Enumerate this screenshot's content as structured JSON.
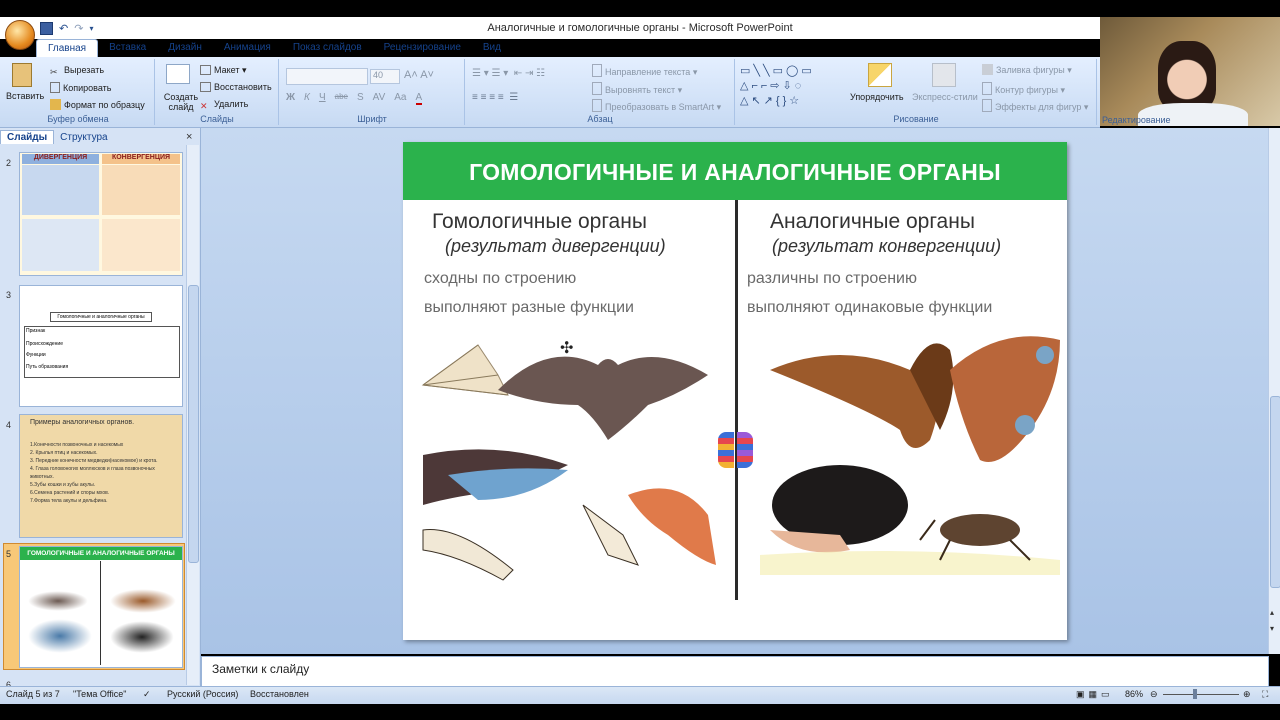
{
  "window": {
    "title": "Аналогичные  и гомологичные органы - Microsoft PowerPoint"
  },
  "ribbon": {
    "tabs": [
      "Главная",
      "Вставка",
      "Дизайн",
      "Анимация",
      "Показ слайдов",
      "Рецензирование",
      "Вид"
    ],
    "active_tab": "Главная",
    "clipboard": {
      "title": "Буфер обмена",
      "paste": "Вставить",
      "cut": "Вырезать",
      "copy": "Копировать",
      "format": "Формат по образцу"
    },
    "slides": {
      "title": "Слайды",
      "create": "Создать слайд",
      "layout": "Макет",
      "reset": "Восстановить",
      "delete": "Удалить"
    },
    "font": {
      "title": "Шрифт",
      "size": "40",
      "buttons": [
        "Ж",
        "К",
        "Ч",
        "abe",
        "S",
        "AV",
        "Aa",
        "A"
      ]
    },
    "paragraph": {
      "title": "Абзац",
      "text_direction": "Направление текста",
      "align_text": "Выровнять текст",
      "smartart": "Преобразовать в SmartArt"
    },
    "drawing": {
      "title": "Рисование",
      "arrange": "Упорядочить",
      "quick_styles": "Экспресс-стили",
      "fill": "Заливка фигуры",
      "outline": "Контур фигуры",
      "effects": "Эффекты для фигур"
    },
    "editing": {
      "title": "Редактирование"
    }
  },
  "left_panel": {
    "tabs": [
      "Слайды",
      "Структура"
    ],
    "close": "×",
    "slide_numbers": [
      "2",
      "3",
      "4",
      "5",
      "6"
    ],
    "thumb2": {
      "left_head": "ДИВЕРГЕНЦИЯ",
      "right_head": "КОНВЕРГЕНЦИЯ"
    },
    "thumb3": {
      "title": "Гомологичные и аналогичные органы",
      "row1": "Признак",
      "row2": "Происхождение",
      "row3": "Функции",
      "row4": "Путь образования"
    },
    "thumb4": {
      "title": "Примеры аналогичных органов.",
      "items": [
        "1.Конечности позвоночных и насекомых",
        "2. Крылья птиц и насекомых.",
        "3. Передние конечности медведки(насекомое) и крота.",
        "4. Глаза головоногих моллюсков и глаза позвоночных животных.",
        "5.Зубы кошки и зубы акулы.",
        "6.Семена растений и споры мхов.",
        "7.Форма тела акулы и дельфина."
      ]
    },
    "thumb5": {
      "title": "ГОМОЛОГИЧНЫЕ И АНАЛОГИЧНЫЕ ОРГАНЫ"
    }
  },
  "slide": {
    "banner": "ГОМОЛОГИЧНЫЕ И АНАЛОГИЧНЫЕ ОРГАНЫ",
    "left": {
      "title": "Гомологичные органы",
      "subtitle": "(результат дивергенции)",
      "line1": "сходны по строению",
      "line2": "выполняют разные функции"
    },
    "right": {
      "title": "Аналогичные органы",
      "subtitle": "(результат конвергенции)",
      "line1": "различны по строению",
      "line2": "выполняют одинаковые функции"
    }
  },
  "notes": {
    "placeholder": "Заметки к слайду"
  },
  "status": {
    "slide": "Слайд 5 из 7",
    "theme": "\"Тема Office\"",
    "language": "Русский (Россия)",
    "state": "Восстановлен",
    "zoom": "86%"
  }
}
